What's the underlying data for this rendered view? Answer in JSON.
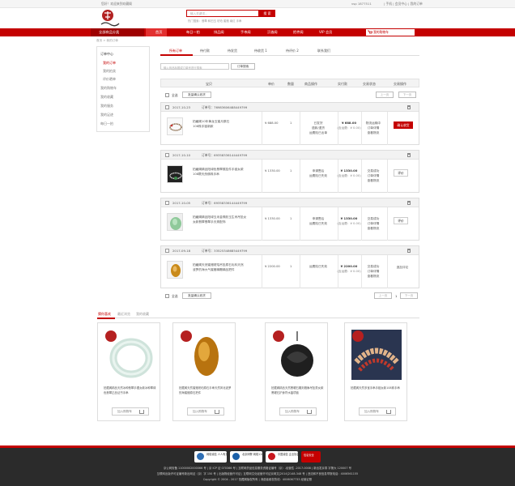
{
  "topbar": {
    "left": "您好！欢迎来到玖藏阁",
    "right_user": "vsp 1877511",
    "right_links": "| 手机 | 会员中心 | 我的订单",
    "cart_link": "我的订单"
  },
  "search": {
    "placeholder": "输入关键词...",
    "button": "搜 索",
    "hot": "热门搜索：翡翠 和田玉 琥珀 蜜蜡 南红 手串"
  },
  "nav": {
    "category": "全部商品分类",
    "items": [
      "首页",
      "每日一拍",
      "排品阁",
      "手串阁",
      "沉香阁",
      "把件阁",
      "VIP 会员"
    ],
    "cart": "我的购物车"
  },
  "breadcrumb": "首页  >  我的订单",
  "sidebar": {
    "items": [
      "订单中心",
      "我的订单",
      "我的拍卖",
      "评价晒单",
      "我的购物车",
      "我的收藏",
      "我的服务",
      "我的足迹",
      "每日一拍"
    ]
  },
  "tabs": [
    "所有订单",
    "待付款",
    "待发货",
    "待收货 1",
    "待评价 2",
    "联系我们"
  ],
  "order_search": {
    "placeholder": "输入商品标题或订单号进行搜索",
    "button": "订单搜索"
  },
  "table_header": [
    "宝贝",
    "单价",
    "数量",
    "商品操作",
    "实付款",
    "交易状态",
    "交易操作"
  ],
  "select_all": "全选",
  "batch_confirm": "批量确认收货",
  "pager": {
    "prev": "上一页",
    "next": "下一页",
    "current": "1"
  },
  "orders": [
    {
      "date": "2017-10-23",
      "number": "订单号：76983606488449799",
      "title1": "拍藏阁10年黄龙玉蜜月原石",
      "title2": "108珠手链新款",
      "price": "¥ 688.00",
      "qty": "1",
      "op": [
        "已发货",
        "退款/退货",
        "运费险已出单"
      ],
      "total": "¥ 688.00",
      "ship": "(含运费：¥ 0.00)",
      "status": [
        "物流运输中",
        "订单详情",
        "查看物流"
      ],
      "action": "确认收货"
    },
    {
      "date": "2017-10-10",
      "number": "订单号：69358336144449799",
      "title1": "拍藏阁精品阳绿色翡翠猴挂件手链女款",
      "title2": "108颗天然佛珠手串",
      "price": "¥ 1330.00",
      "qty": "1",
      "op": [
        "申请售后",
        "运费险已失效"
      ],
      "total": "¥ 1330.00",
      "ship": "(含运费：¥ 0.00)",
      "status": [
        "交易成功",
        "订单详情",
        "查看物流"
      ],
      "action": "评价"
    },
    {
      "date": "2017-10-05",
      "number": "订单号：69358336144449799",
      "title1": "拍藏阁精品阳绿玉米金橡胶玉生肖吊坠女",
      "title2": "女款翡翠翡翠手天珠配饰",
      "price": "¥ 1330.00",
      "qty": "1",
      "op": [
        "申请售后",
        "运费险已失效"
      ],
      "total": "¥ 1330.00",
      "ship": "(含运费：¥ 0.00)",
      "status": [
        "交易成功",
        "订单详情",
        "查看物流"
      ],
      "action": "评价"
    },
    {
      "date": "2017-09-18",
      "number": "订单号：33525348685449799",
      "title1": "拍藏阁天然蜜蜡琥珀吊坠原石毛料天然",
      "title2": "波罗的海大气蜜蜡精雕精品把件",
      "price": "¥ 2200.00",
      "qty": "1",
      "op": [
        "运费险已失效"
      ],
      "total": "¥ 2200.00",
      "ship": "(含运费：¥ 0.00)",
      "status": [
        "交易成功",
        "订单详情",
        "查看物流"
      ],
      "action": "追加评论"
    }
  ],
  "reco_tabs": [
    "猜你喜欢",
    "最近浏览",
    "我的收藏"
  ],
  "products": [
    {
      "title": "拍藏阁精品天然冰种翡翠手镯女款冰种翠绿色翡翠正品证书手串",
      "add": "加入购物车"
    },
    {
      "title": "拍藏阁天然蜜蜡琥珀原石手串天然风化波罗的海蜜蜡原石把件",
      "add": "加入购物车"
    },
    {
      "title": "拍藏阁精品天然黑曜石雕刻貔貅吊坠男女款黑曜石护身符水晶项链",
      "add": "加入购物车"
    },
    {
      "title": "拍藏阁天然多宝手串手链女款108珠手串",
      "add": "加入购物车"
    }
  ],
  "footer": {
    "badges": [
      "网络诚信 人人有责",
      "北京网警 网络110",
      "中国诚信 企业协会",
      "信息安全"
    ],
    "lines": [
      "京公网安备 11000002000066 号 | 京 ICP 证 070366 号 | 互联网药品信息服务资格证编号（京）-经营性 -2017-0008 | 新出发京零 字第大 120007 号",
      "互联网出版许可证编号新出网证（京）字 150 号 | 出版物经营许可证 | 互联网文化经营许可证京网文[2014]2148-348 号 | 违法和不良信息举报电话：4006561155",
      "Copyright © 2004 - 2017 拍藏阁版权所有 | 消费者维权热线：4006067733 经营证照"
    ]
  },
  "colors": {
    "accent": "#c40000",
    "accent_dark": "#9e0000",
    "footer_bg": "#2b2b2b"
  }
}
